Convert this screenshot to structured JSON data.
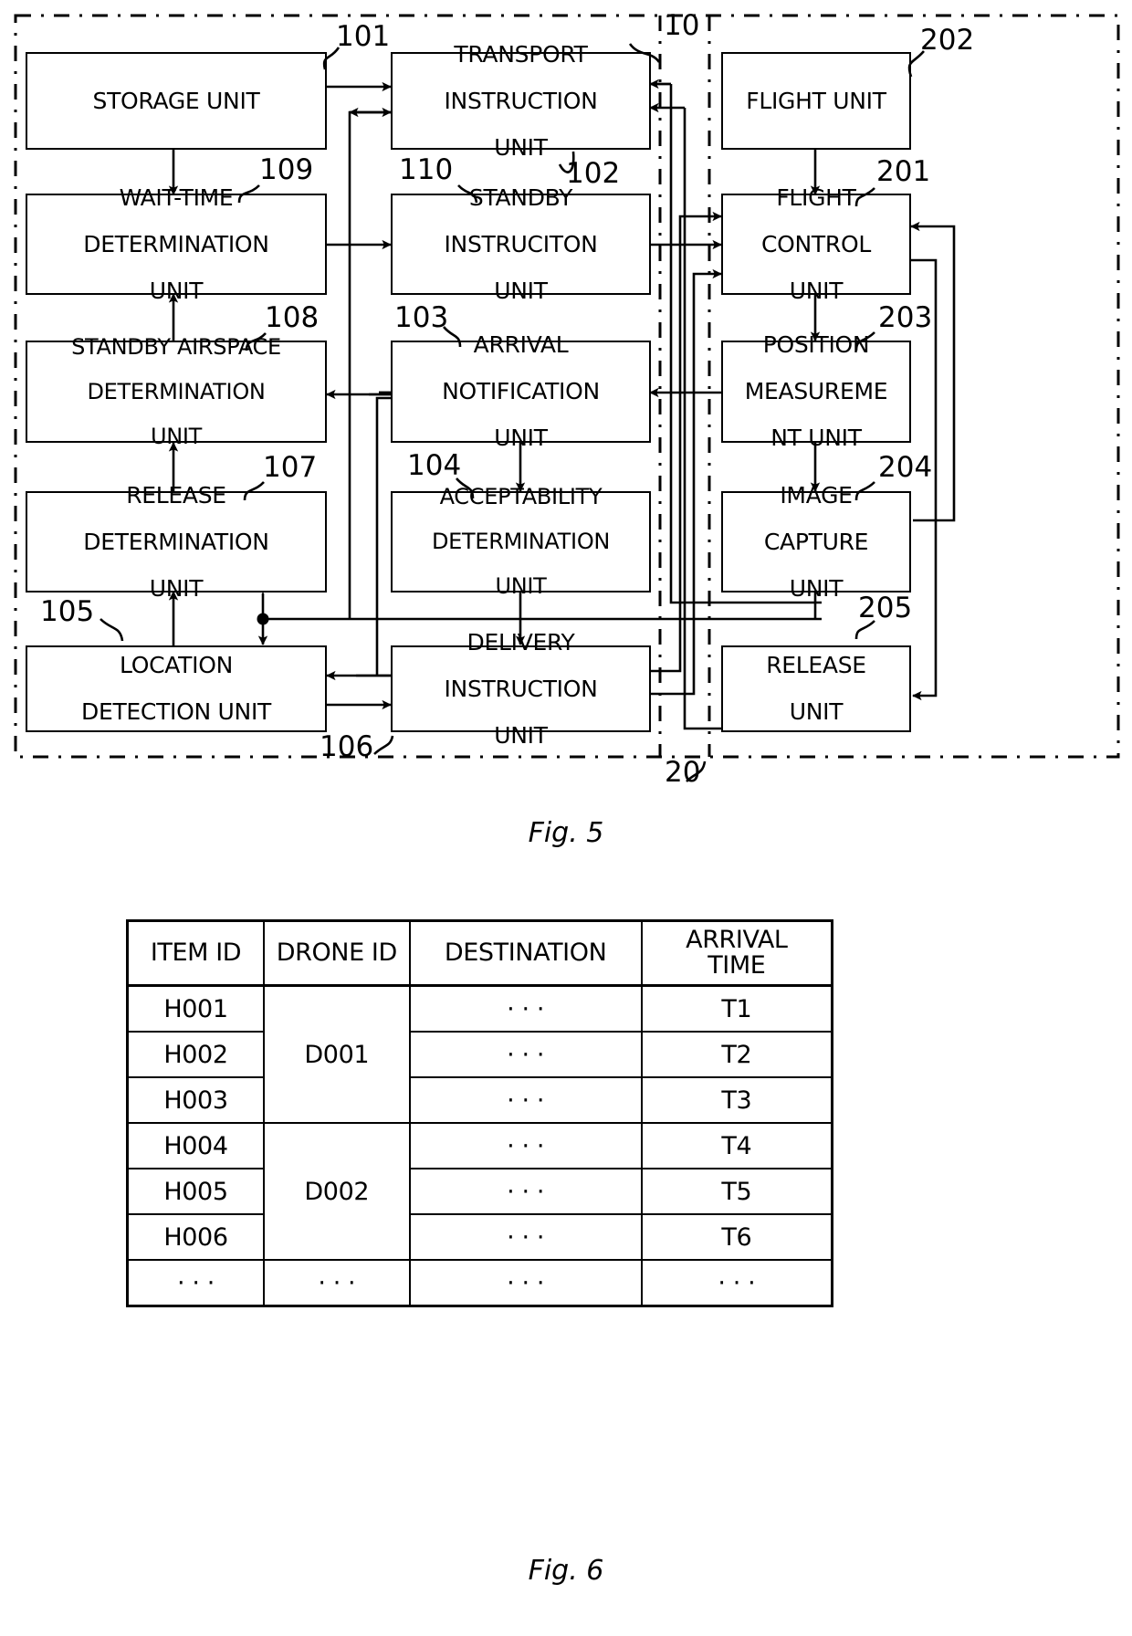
{
  "figures": {
    "fig5": {
      "caption": "Fig. 5",
      "system_label": "10",
      "drone_label": "20",
      "blocks": [
        {
          "id": "b101",
          "ref": "101",
          "lines": [
            "STORAGE UNIT"
          ]
        },
        {
          "id": "b102",
          "ref": "102",
          "lines": [
            "TRANSPORT",
            "INSTRUCTION",
            "UNIT"
          ]
        },
        {
          "id": "b109",
          "ref": "109",
          "lines": [
            "WAIT-TIME",
            "DETERMINATION",
            "UNIT"
          ]
        },
        {
          "id": "b110",
          "ref": "110",
          "lines": [
            "STANDBY",
            "INSTRUCITON",
            "UNIT"
          ]
        },
        {
          "id": "b108",
          "ref": "108",
          "lines": [
            "STANDBY AIRSPACE",
            "DETERMINATION",
            "UNIT"
          ]
        },
        {
          "id": "b103",
          "ref": "103",
          "lines": [
            "ARRIVAL",
            "NOTIFICATION",
            "UNIT"
          ]
        },
        {
          "id": "b107",
          "ref": "107",
          "lines": [
            "RELEASE",
            "DETERMINATION",
            "UNIT"
          ]
        },
        {
          "id": "b104",
          "ref": "104",
          "lines": [
            "ACCEPTABILITY",
            "DETERMINATION",
            "UNIT"
          ]
        },
        {
          "id": "b105",
          "ref": "105",
          "lines": [
            "LOCATION",
            "DETECTION UNIT"
          ]
        },
        {
          "id": "b106",
          "ref": "106",
          "lines": [
            "DELIVERY",
            "INSTRUCTION",
            "UNIT"
          ]
        },
        {
          "id": "b202",
          "ref": "202",
          "lines": [
            "FLIGHT UNIT"
          ]
        },
        {
          "id": "b201",
          "ref": "201",
          "lines": [
            "FLIGHT",
            "CONTROL",
            "UNIT"
          ]
        },
        {
          "id": "b203",
          "ref": "203",
          "lines": [
            "POSITION",
            "MEASUREME",
            "NT UNIT"
          ]
        },
        {
          "id": "b204",
          "ref": "204",
          "lines": [
            "IMAGE",
            "CAPTURE",
            "UNIT"
          ]
        },
        {
          "id": "b205",
          "ref": "205",
          "lines": [
            "RELEASE",
            "UNIT"
          ]
        }
      ]
    },
    "fig6": {
      "caption": "Fig. 6",
      "ellipsis": "· · ·",
      "table": {
        "type": "table",
        "columns": [
          "ITEM ID",
          "DRONE ID",
          "DESTINATION",
          "ARRIVAL TIME"
        ],
        "column_header_lines": [
          [
            "ITEM ID"
          ],
          [
            "DRONE ID"
          ],
          [
            "DESTINATION"
          ],
          [
            "ARRIVAL",
            "TIME"
          ]
        ],
        "rows": [
          {
            "item_id": "H001",
            "drone_id": "D001",
            "destination": "· · ·",
            "arrival_time": "T1"
          },
          {
            "item_id": "H002",
            "drone_id": "D001",
            "destination": "· · ·",
            "arrival_time": "T2"
          },
          {
            "item_id": "H003",
            "drone_id": "D001",
            "destination": "· · ·",
            "arrival_time": "T3"
          },
          {
            "item_id": "H004",
            "drone_id": "D002",
            "destination": "· · ·",
            "arrival_time": "T4"
          },
          {
            "item_id": "H005",
            "drone_id": "D002",
            "destination": "· · ·",
            "arrival_time": "T5"
          },
          {
            "item_id": "H006",
            "drone_id": "D002",
            "destination": "· · ·",
            "arrival_time": "T6"
          },
          {
            "item_id": "· · ·",
            "drone_id": "· · ·",
            "destination": "· · ·",
            "arrival_time": "· · ·"
          }
        ],
        "drone_groups": [
          {
            "label": "D001",
            "span": 3
          },
          {
            "label": "D002",
            "span": 3
          }
        ]
      }
    }
  }
}
